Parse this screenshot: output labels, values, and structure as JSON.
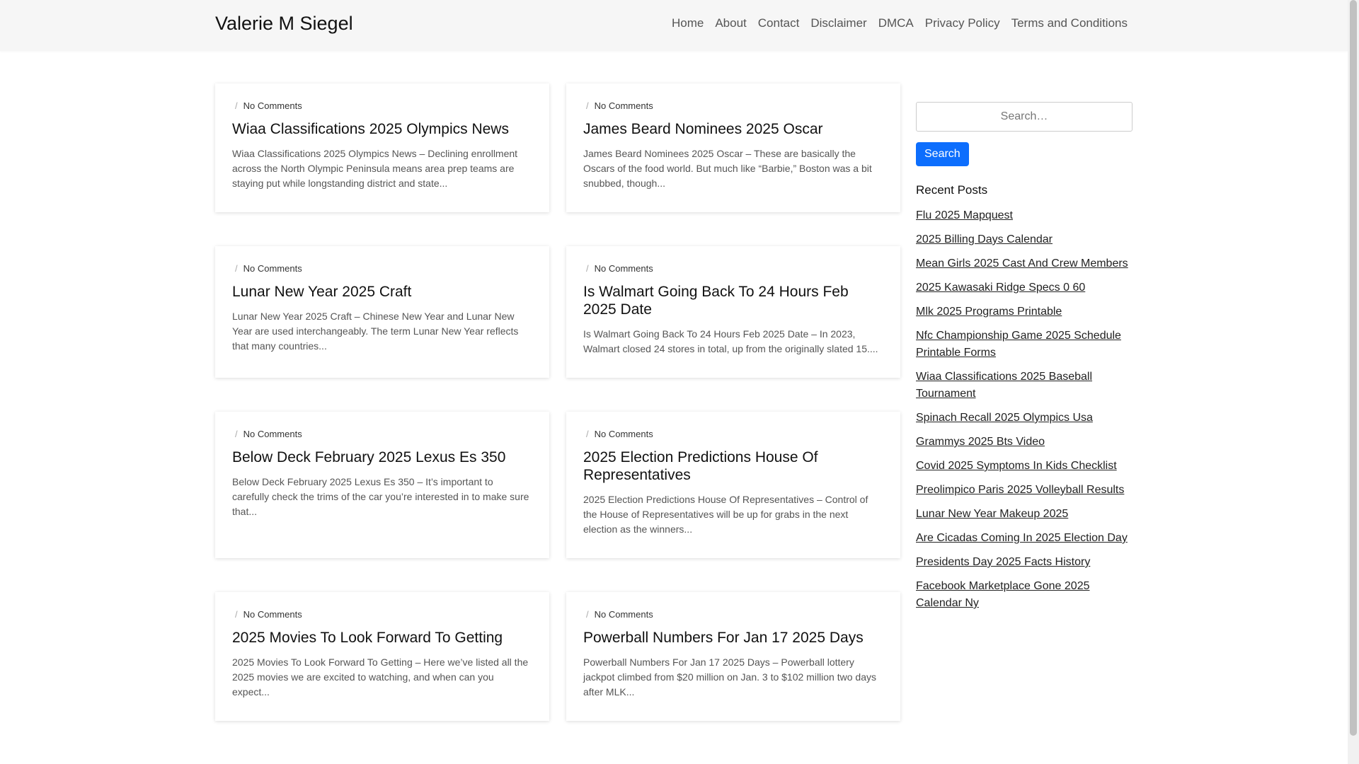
{
  "header": {
    "site_title": "Valerie M Siegel",
    "nav": [
      "Home",
      "About",
      "Contact",
      "Disclaimer",
      "DMCA",
      "Privacy Policy",
      "Terms and Conditions"
    ]
  },
  "posts": [
    {
      "meta": "No Comments",
      "title": "Wiaa Classifications 2025 Olympics News",
      "excerpt": "Wiaa Classifications 2025 Olympics News – Declining enrollment across the North Olympic Peninsula means area prep teams are staying put while longstanding district and state..."
    },
    {
      "meta": "No Comments",
      "title": "James Beard Nominees 2025 Oscar",
      "excerpt": "James Beard Nominees 2025 Oscar – These are basically the Oscars of the food world. But much like “Barbie,” Boston was a bit snubbed, though..."
    },
    {
      "meta": "No Comments",
      "title": "Lunar New Year 2025 Craft",
      "excerpt": "Lunar New Year 2025 Craft – Chinese New Year and Lunar New Year are used interchangeably. The term Lunar New Year reflects that many countries..."
    },
    {
      "meta": "No Comments",
      "title": "Is Walmart Going Back To 24 Hours Feb 2025 Date",
      "excerpt": "Is Walmart Going Back To 24 Hours Feb 2025 Date – In 2023, Walmart closed 24 stores in total, up from the originally slated 15...."
    },
    {
      "meta": "No Comments",
      "title": "Below Deck February 2025 Lexus Es 350",
      "excerpt": "Below Deck February 2025 Lexus Es 350 – It’s important to carefully check the trims of the car you’re interested in to make sure that..."
    },
    {
      "meta": "No Comments",
      "title": "2025 Election Predictions House Of Representatives",
      "excerpt": "2025 Election Predictions House Of Representatives – Control of the House of Representatives will be up for grabs in the next election as the winners..."
    },
    {
      "meta": "No Comments",
      "title": "2025 Movies To Look Forward To Getting",
      "excerpt": "2025 Movies To Look Forward To Getting – Here we’ve listed all the 2025 movies we are excited to watching, and when can you expect..."
    },
    {
      "meta": "No Comments",
      "title": "Powerball Numbers For Jan 17 2025 Days",
      "excerpt": "Powerball Numbers For Jan 17 2025 Days – Powerball lottery jackpot climbed from $20 million on Jan. 3 to $102 million two days after MLK..."
    }
  ],
  "sidebar": {
    "search_placeholder": "Search…",
    "search_button": "Search",
    "recent_title": "Recent Posts",
    "recent_posts": [
      "Flu 2025 Mapquest",
      "2025 Billing Days Calendar",
      "Mean Girls 2025 Cast And Crew Members",
      "2025 Kawasaki Ridge Specs 0 60",
      "Mlk 2025 Programs Printable",
      "Nfc Championship Game 2025 Schedule Printable Forms",
      "Wiaa Classifications 2025 Baseball Tournament",
      "Spinach Recall 2025 Olympics Usa",
      "Grammys 2025 Bts Video",
      "Covid 2025 Symptoms In Kids Checklist",
      "Preolimpico Paris 2025 Volleyball Results",
      "Lunar New Year Makeup 2025",
      "Are Cicadas Coming In 2025 Election Day",
      "Presidents Day 2025 Facts History",
      "Facebook Marketplace Gone 2025 Calendar Ny"
    ]
  },
  "colors": {
    "accent": "#0d6efd",
    "header_bg": "#f6f6f6"
  }
}
